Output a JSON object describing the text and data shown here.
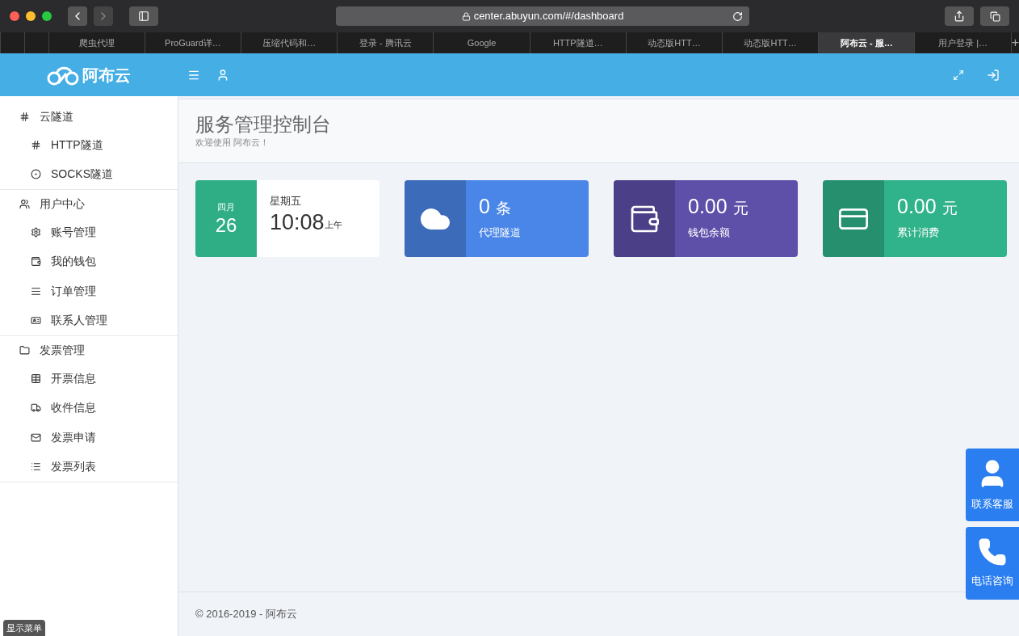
{
  "browser": {
    "url": "center.abuyun.com/#/dashboard",
    "tabs": [
      {
        "selected": false
      },
      {
        "selected": false
      },
      {
        "label": "爬虫代理",
        "selected": false
      },
      {
        "label": "ProGuard详…",
        "selected": false
      },
      {
        "label": "压缩代码和…",
        "selected": false
      },
      {
        "label": "登录 - 腾讯云",
        "selected": false
      },
      {
        "label": "Google",
        "selected": false
      },
      {
        "label": "HTTP隧道…",
        "selected": false
      },
      {
        "label": "动态版HTT…",
        "selected": false
      },
      {
        "label": "动态版HTT…",
        "selected": false
      },
      {
        "label": "阿布云 - 服…",
        "selected": true
      },
      {
        "label": "用户登录 |…",
        "selected": false
      }
    ],
    "new_tab": "+"
  },
  "header": {
    "logo": "阿布云"
  },
  "sidebar": {
    "groups": [
      {
        "label": "云隧道",
        "children": [
          {
            "label": "HTTP隧道"
          },
          {
            "label": "SOCKS隧道"
          }
        ]
      },
      {
        "label": "用户中心",
        "children": [
          {
            "label": "账号管理"
          },
          {
            "label": "我的钱包"
          },
          {
            "label": "订单管理"
          },
          {
            "label": "联系人管理"
          }
        ]
      },
      {
        "label": "发票管理",
        "children": [
          {
            "label": "开票信息"
          },
          {
            "label": "收件信息"
          },
          {
            "label": "发票申请"
          },
          {
            "label": "发票列表"
          }
        ]
      }
    ]
  },
  "page": {
    "title": "服务管理控制台",
    "subtitle": "欢迎使用 阿布云！"
  },
  "cards": [
    {
      "kind": "date",
      "color": "#2fae86",
      "month": "四月",
      "day": "26",
      "weekday": "星期五",
      "time": "10:08",
      "ampm": "上午"
    },
    {
      "kind": "stat",
      "color": "#4a86e8",
      "value": "0",
      "unit": "条",
      "label": "代理隧道"
    },
    {
      "kind": "stat",
      "color": "#5e4fa9",
      "value": "0.00",
      "unit": "元",
      "label": "钱包余额"
    },
    {
      "kind": "stat",
      "color": "#30b38a",
      "value": "0.00",
      "unit": "元",
      "label": "累计消费"
    }
  ],
  "footer": "© 2016-2019 - 阿布云",
  "float_buttons": [
    "联系客服",
    "电话咨询"
  ],
  "menu_toggle": "显示菜单"
}
